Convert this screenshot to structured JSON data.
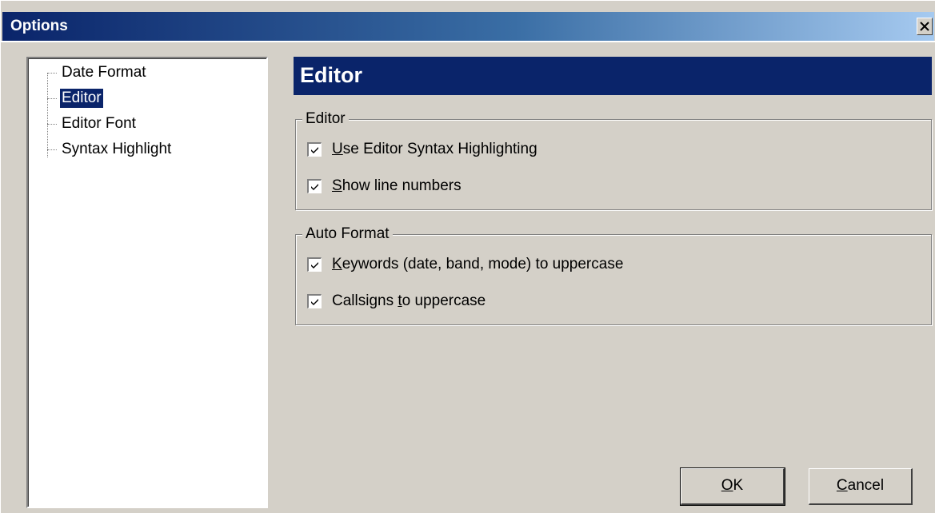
{
  "window": {
    "title": "Options",
    "close_icon": "close-icon"
  },
  "tree": {
    "items": [
      {
        "label": "Date Format",
        "selected": false
      },
      {
        "label": "Editor",
        "selected": true
      },
      {
        "label": "Editor Font",
        "selected": false
      },
      {
        "label": "Syntax Highlight",
        "selected": false
      }
    ]
  },
  "panel": {
    "header": "Editor",
    "groups": [
      {
        "title": "Editor",
        "options": [
          {
            "mnemonic": "U",
            "rest": "se Editor Syntax Highlighting",
            "checked": true
          },
          {
            "mnemonic": "S",
            "rest": "how line numbers",
            "checked": true
          }
        ]
      },
      {
        "title": "Auto Format",
        "options": [
          {
            "mnemonic": "K",
            "rest": "eywords (date, band, mode) to uppercase",
            "checked": true
          },
          {
            "prefix": "Callsigns ",
            "mnemonic": "t",
            "rest": "o uppercase",
            "checked": true
          }
        ]
      }
    ]
  },
  "buttons": {
    "ok": {
      "mnemonic": "O",
      "rest": "K"
    },
    "cancel": {
      "mnemonic": "C",
      "rest": "ancel"
    }
  },
  "colors": {
    "titlebar_start": "#0a246a",
    "titlebar_end": "#a6caf0",
    "selection": "#0a246a",
    "face": "#d4d0c8"
  }
}
